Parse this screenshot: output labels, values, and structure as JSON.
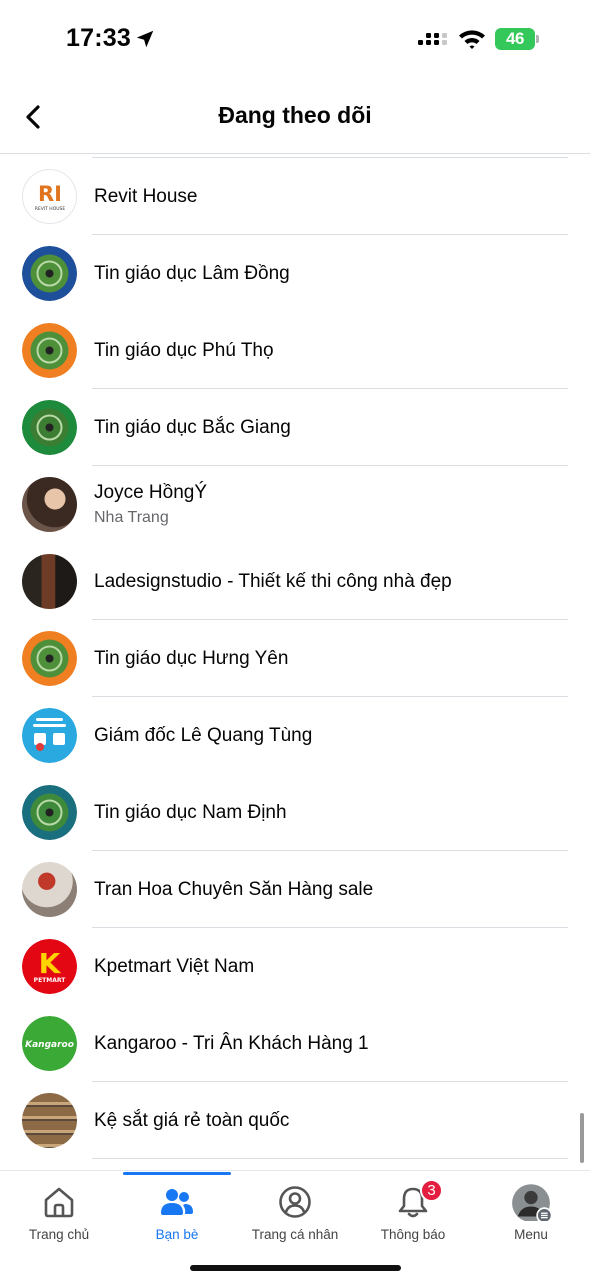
{
  "status_bar": {
    "time": "17:33",
    "battery": "46"
  },
  "header": {
    "title": "Đang theo dõi"
  },
  "following": [
    {
      "name": "Revit House",
      "subtitle": "",
      "avatar_text": "RI",
      "avatar_caption": "REVIT HOUSE"
    },
    {
      "name": "Tin giáo dục Lâm Đồng",
      "subtitle": ""
    },
    {
      "name": "Tin giáo dục Phú Thọ",
      "subtitle": ""
    },
    {
      "name": "Tin giáo dục Bắc Giang",
      "subtitle": ""
    },
    {
      "name": "Joyce HồngÝ",
      "subtitle": "Nha Trang"
    },
    {
      "name": "Ladesignstudio - Thiết kế thi công nhà đẹp",
      "subtitle": ""
    },
    {
      "name": "Tin giáo dục Hưng Yên",
      "subtitle": ""
    },
    {
      "name": "Giám đốc Lê Quang Tùng",
      "subtitle": ""
    },
    {
      "name": "Tin giáo dục Nam Định",
      "subtitle": ""
    },
    {
      "name": "Tran Hoa Chuyên Săn Hàng sale",
      "subtitle": ""
    },
    {
      "name": "Kpetmart Việt Nam",
      "subtitle": "",
      "avatar_text": "K",
      "avatar_caption": "PETMART"
    },
    {
      "name": "Kangaroo - Tri Ân Khách Hàng 1",
      "subtitle": "",
      "avatar_text": "Kangaroo"
    },
    {
      "name": "Kệ sắt giá rẻ toàn quốc",
      "subtitle": ""
    }
  ],
  "tabbar": {
    "tabs": [
      {
        "label": "Trang chủ",
        "icon": "home-icon"
      },
      {
        "label": "Bạn bè",
        "icon": "friends-icon"
      },
      {
        "label": "Trang cá nhân",
        "icon": "profile-icon"
      },
      {
        "label": "Thông báo",
        "icon": "bell-icon",
        "badge": "3"
      },
      {
        "label": "Menu",
        "icon": "menu-avatar-icon"
      }
    ]
  },
  "colors": {
    "accent": "#1877f2",
    "badge": "#e41e3f",
    "battery": "#34c759"
  }
}
